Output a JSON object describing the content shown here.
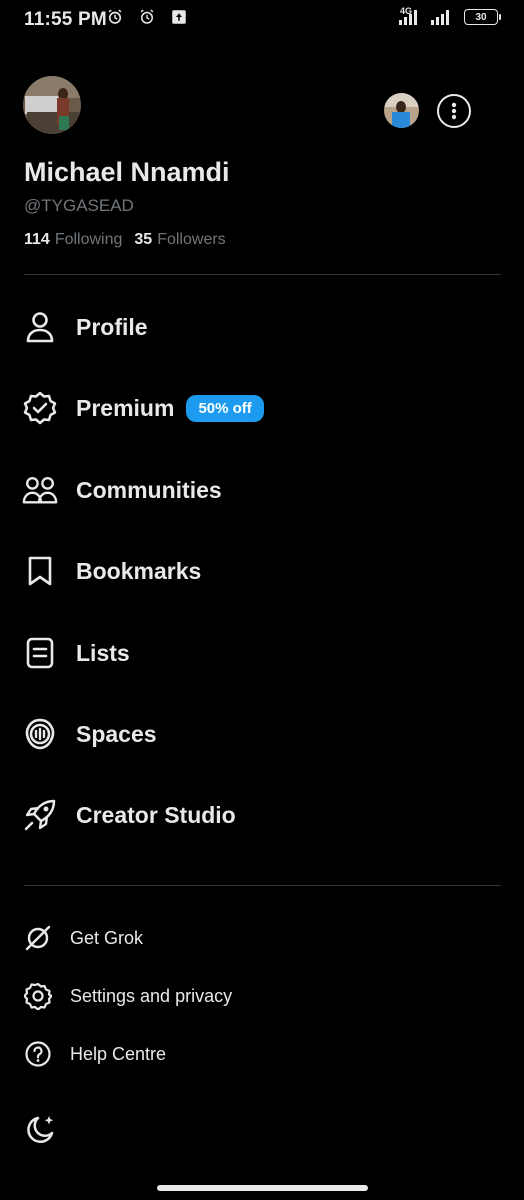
{
  "status_bar": {
    "time": "11:55 PM",
    "network": "4G",
    "battery": "30"
  },
  "profile": {
    "display_name": "Michael Nnamdi",
    "handle": "@TYGASEAD",
    "following_count": "114",
    "following_label": "Following",
    "followers_count": "35",
    "followers_label": "Followers"
  },
  "nav": {
    "items": [
      {
        "label": "Profile",
        "icon": "person-icon"
      },
      {
        "label": "Premium",
        "icon": "verified-badge-icon",
        "badge": "50% off"
      },
      {
        "label": "Communities",
        "icon": "communities-icon"
      },
      {
        "label": "Bookmarks",
        "icon": "bookmark-icon"
      },
      {
        "label": "Lists",
        "icon": "list-icon"
      },
      {
        "label": "Spaces",
        "icon": "spaces-icon"
      },
      {
        "label": "Creator Studio",
        "icon": "rocket-icon"
      }
    ]
  },
  "secondary": {
    "items": [
      {
        "label": "Get Grok",
        "icon": "grok-icon"
      },
      {
        "label": "Settings and privacy",
        "icon": "gear-icon"
      },
      {
        "label": "Help Centre",
        "icon": "help-icon"
      }
    ]
  },
  "colors": {
    "background": "#000000",
    "text_primary": "#e7e9ea",
    "text_secondary": "#71767b",
    "accent": "#1d9bf0",
    "divider": "#2f3336"
  }
}
